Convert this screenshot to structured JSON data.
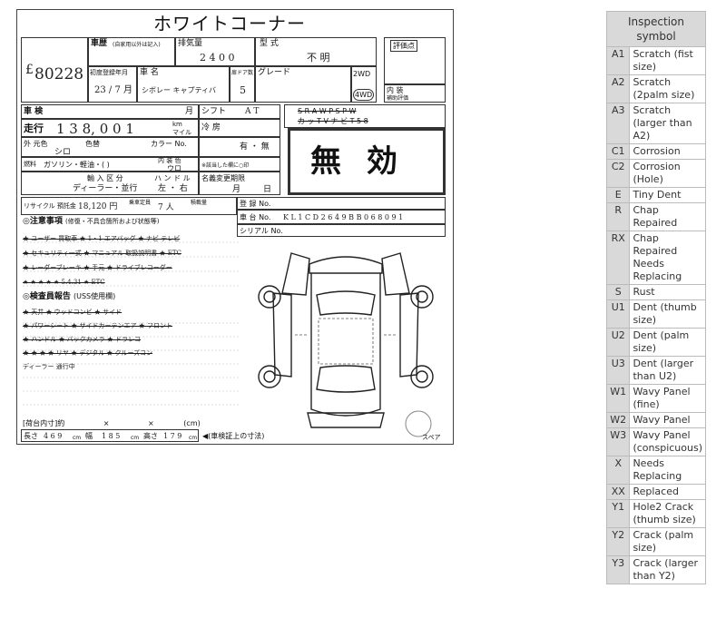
{
  "sheet": {
    "title": "ホワイトコーナー",
    "lot": "80228",
    "lot_prefix": "£",
    "labels": {
      "history": "車歴",
      "history_note": "(自家用以外は記入)",
      "displacement": "排気量",
      "model": "型 式",
      "eval": "評価点",
      "first_reg": "初度登録年月",
      "car_name": "車 名",
      "doors": "扉ドア数",
      "grade": "グレード",
      "drive_2wd": "2WD",
      "drive_4wd": "4WD",
      "interior": "内 装",
      "interior_sub": "補助評価",
      "inspection": "車 検",
      "month": "月",
      "shift": "シフト",
      "mileage": "走行",
      "km": "km",
      "mile": "マイル",
      "ext_color": "外 元色",
      "color_name": "色替",
      "color_no": "カラー No.",
      "fuel": "燃料",
      "fuel_options": "ガソリン・軽油・(        )",
      "interior_color": "内 装 色",
      "import_cat": "輸 入 区 分",
      "handle": "ハ ン ド ル",
      "dealer": "ディーラー・並行",
      "handle_val": "左 ・ 右",
      "name_change": "名義変更期限",
      "day": "日",
      "recycle": "リサイクル 預託金",
      "capacity": "乗車定員",
      "load": "積載量",
      "reg_no": "登 録 No.",
      "chassis": "車 台 No.",
      "serial": "シリアル No.",
      "caution": "◎注意事項",
      "caution_note": "(修復・不具合箇所および状態等)",
      "report": "◎検査員報告",
      "report_note": "(USS使用欄)",
      "cargo": "[荷台内寸]約",
      "cargo_x1": "×",
      "cargo_x2": "×",
      "cargo_unit": "(cm)",
      "length": "長さ",
      "width": "幅",
      "height": "高さ",
      "cm": "cm",
      "dim_note": "◀(車検証上の寸法)",
      "spare": "スペア",
      "aircon": "冷 房",
      "ac_yes_no": "有 ・ 無",
      "ac_note": "※該当した欄に○印",
      "options_row1": "S R   A W   P S   P W",
      "options_row2": "カ ッ  T V   ナ ビ   T  5 8"
    },
    "values": {
      "displacement": "2 4 0 0",
      "model": "不 明",
      "first_reg": "23 / 7 月",
      "car_name": "シボレー キャプティバ",
      "doors": "5",
      "shift": "A T",
      "mileage": "1 3 8, 0 0 1",
      "ext_color": "シロ",
      "interior_color": "ウロ",
      "recycle_amount": "18,120 円",
      "capacity": "7 人",
      "chassis": "K L 1 C D 2 6 4 9 B B 0 6 8 0 9 1",
      "length": "4 6 9",
      "width": "1 8 5",
      "height": "1 7 9",
      "invalid_stamp": "無 効",
      "caution_lines": [
        "★ ユーザー 買取車 ★ 1・1 エアバッグ ★ ナビ テレビ",
        "★ セキュリティ一式 ★ マニュアル 取扱説明書 ★ ETC",
        "★ レーダーブレーキ ★ 手元 ★ ドライブレコーダー",
        "★ ★ ★ ★ ★ 5.4.31 ★ ETC"
      ],
      "report_lines": [
        "★ 天井 ★ ウッドコンビ ★ サイド",
        "★ パワーシート ★ サイドカーテンエア ★ フロント",
        "★ ハンドル ★ バックカメラ ★ ドラレコ",
        "★ ★ ★ ★ リヤ ★ デジタル ★ クルーズコン",
        "ディーラー 通行中"
      ]
    }
  },
  "legend": {
    "header": "Inspection symbol",
    "rows": [
      {
        "code": "A1",
        "desc": "Scratch (fist size)"
      },
      {
        "code": "A2",
        "desc": "Scratch (2palm size)"
      },
      {
        "code": "A3",
        "desc": "Scratch (larger than A2)"
      },
      {
        "code": "C1",
        "desc": "Corrosion"
      },
      {
        "code": "C2",
        "desc": "Corrosion (Hole)"
      },
      {
        "code": "E",
        "desc": "Tiny Dent"
      },
      {
        "code": "R",
        "desc": "Chap Repaired"
      },
      {
        "code": "RX",
        "desc": "Chap Repaired Needs Replacing"
      },
      {
        "code": "S",
        "desc": "Rust"
      },
      {
        "code": "U1",
        "desc": "Dent (thumb size)"
      },
      {
        "code": "U2",
        "desc": "Dent (palm size)"
      },
      {
        "code": "U3",
        "desc": "Dent (larger than U2)"
      },
      {
        "code": "W1",
        "desc": "Wavy Panel (fine)"
      },
      {
        "code": "W2",
        "desc": "Wavy Panel"
      },
      {
        "code": "W3",
        "desc": "Wavy Panel (conspicuous)"
      },
      {
        "code": "X",
        "desc": "Needs Replacing"
      },
      {
        "code": "XX",
        "desc": "Replaced"
      },
      {
        "code": "Y1",
        "desc": "Hole2 Crack (thumb size)"
      },
      {
        "code": "Y2",
        "desc": "Crack (palm size)"
      },
      {
        "code": "Y3",
        "desc": "Crack (larger than Y2)"
      }
    ]
  }
}
